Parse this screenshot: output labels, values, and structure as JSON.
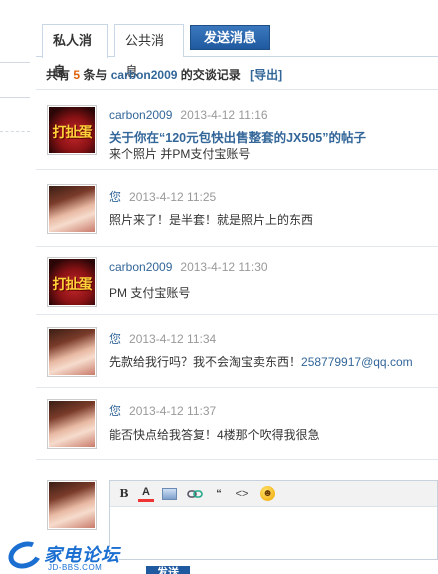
{
  "tabs": {
    "private_label": "私人消息",
    "public_label": "公共消息",
    "send_label": "发送消息"
  },
  "summary": {
    "prefix": "共有",
    "count": "5",
    "middle": "条与",
    "user": "carbon2009",
    "suffix": "的交谈记录",
    "export_label": "[导出]"
  },
  "messages": [
    {
      "sender": "carbon2009",
      "time": "2013-4-12 11:16",
      "title": "关于你在“120元包快出售整套的JX505”的帖子",
      "text": "来个照片 并PM支付宝账号",
      "avatar": "egg"
    },
    {
      "sender": "您",
      "time": "2013-4-12 11:25",
      "text": "照片来了！是半套！就是照片上的东西",
      "avatar": "girl"
    },
    {
      "sender": "carbon2009",
      "time": "2013-4-12 11:30",
      "text": "PM 支付宝账号",
      "avatar": "egg"
    },
    {
      "sender": "您",
      "time": "2013-4-12 11:34",
      "text": "先款给我行吗？我不会淘宝卖东西！",
      "email": "258779917@qq.com",
      "avatar": "girl"
    },
    {
      "sender": "您",
      "time": "2013-4-12 11:37",
      "text": "能否快点给我答复！4楼那个吹得我很急",
      "avatar": "girl"
    }
  ],
  "avatar_egg_text": "打扯蛋",
  "editor": {
    "tools": [
      "bold-icon",
      "font-color-icon",
      "image-icon",
      "link-icon",
      "quote-icon",
      "code-icon",
      "smiley-icon"
    ],
    "bold": "B",
    "font_color": "A",
    "quote": "“",
    "code": "<>",
    "smiley": "☻"
  },
  "send_button_label": "发送",
  "watermark": {
    "brand": "家电论坛",
    "domain": "JD-BBS.COM"
  },
  "colors": {
    "link": "#336699",
    "count": "#e0600a",
    "send_button": "#1f5aa0"
  }
}
